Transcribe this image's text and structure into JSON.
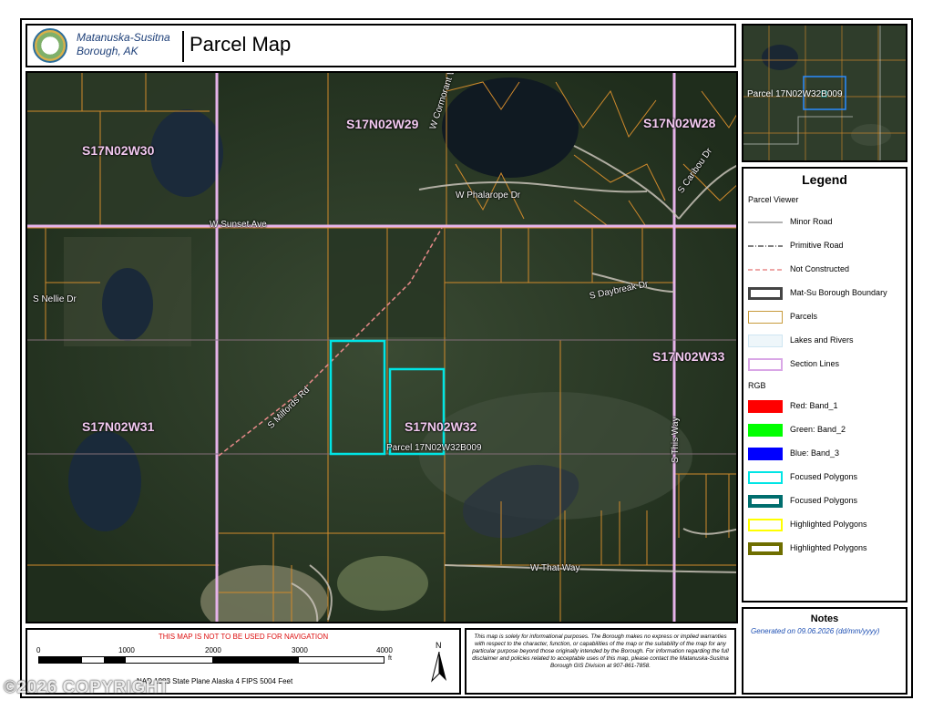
{
  "header": {
    "borough_line1": "Matanuska-Susitna",
    "borough_line2": "Borough, AK",
    "title": "Parcel Map"
  },
  "map": {
    "section_labels": [
      "S17N02W30",
      "S17N02W29",
      "S17N02W28",
      "S17N02W31",
      "S17N02W33",
      "S17N02W32"
    ],
    "road_labels": [
      "W Sunset Ave",
      "W Phalarope Dr",
      "W Cormorant Way",
      "S Caribou Dr",
      "S Nellie Dr",
      "S Daybreak Dr",
      "S Milfords Rd",
      "S This Way",
      "W That Way"
    ],
    "parcel_label": "Parcel 17N02W32B009"
  },
  "inset": {
    "parcel_label": "Parcel 17N02W32B009"
  },
  "legend": {
    "title": "Legend",
    "subtitle": "Parcel Viewer",
    "rgb_label": "RGB",
    "items": [
      {
        "label": "Minor Road",
        "color": "#999999"
      },
      {
        "label": "Primitive Road",
        "color": "#555555"
      },
      {
        "label": "Not Constructed",
        "color": "#e88a8a"
      },
      {
        "label": "Mat-Su Borough Boundary",
        "color": "#444444"
      },
      {
        "label": "Parcels",
        "color": "#c89b3c"
      },
      {
        "label": "Lakes and Rivers",
        "color": "#cfe6f2"
      },
      {
        "label": "Section Lines",
        "color": "#d9a6e6"
      },
      {
        "label": "Red:   Band_1",
        "color": "#ff0000"
      },
      {
        "label": "Green: Band_2",
        "color": "#00ff00"
      },
      {
        "label": "Blue:  Band_3",
        "color": "#0000ff"
      },
      {
        "label": "Focused Polygons",
        "color": "#00e5e5"
      },
      {
        "label": "Focused Polygons",
        "color": "#006e6e"
      },
      {
        "label": "Highlighted Polygons",
        "color": "#ffff00"
      },
      {
        "label": "Highlighted Polygons",
        "color": "#6e6e00"
      }
    ]
  },
  "notes": {
    "title": "Notes",
    "generated": "Generated on  09.06.2026  (dd/mm/yyyy)"
  },
  "scale": {
    "warning": "THIS MAP IS NOT TO BE USED FOR NAVIGATION",
    "ticks": [
      "0",
      "1000",
      "2000",
      "3000",
      "4000"
    ],
    "unit": "ft",
    "projection": "NAD 1983 State Plane Alaska 4 FIPS 5004 Feet",
    "north": "N"
  },
  "disclaimer": "This map is solely for informational purposes. The Borough makes no express or implied warranties with respect to the character, function, or capabilities of the map or the suitability of the map for any particular purpose beyond those originally intended by the Borough. For information regarding the full disclaimer and policies related to acceptable uses of this map, please contact the Matanuska-Susitna Borough GIS Division at 907-861-7858.",
  "watermark": "©2026 COPYRIGHT"
}
